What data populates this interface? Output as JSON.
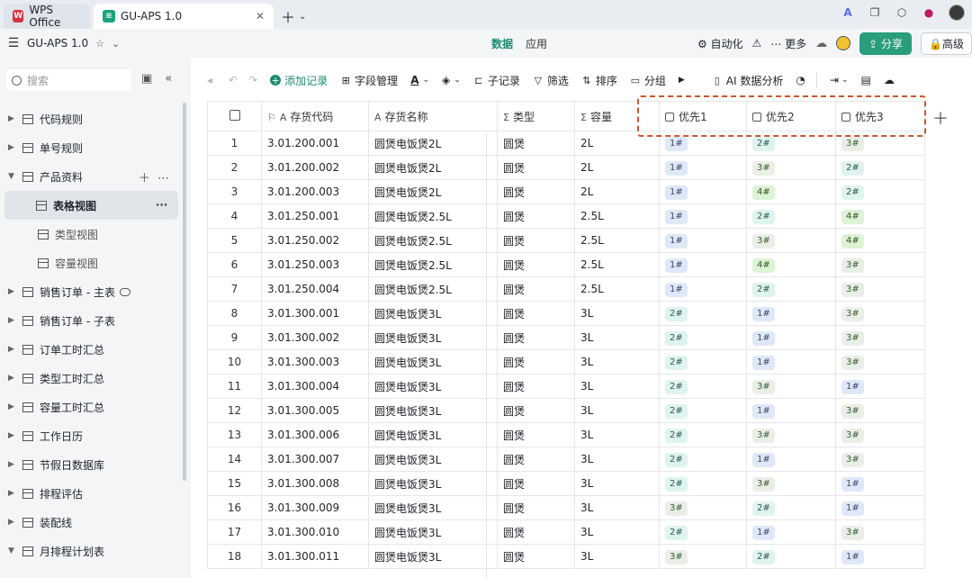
{
  "tabs": [
    {
      "label": "WPS Office",
      "active": false
    },
    {
      "label": "GU-APS 1.0",
      "active": true
    }
  ],
  "app": {
    "name": "GU-APS 1.0",
    "center_tabs": [
      "数据",
      "应用"
    ],
    "automation": "自动化",
    "more": "更多",
    "share": "分享",
    "high": "高级"
  },
  "sidebar": {
    "search_placeholder": "搜索",
    "items": [
      {
        "label": "代码规则",
        "type": "table"
      },
      {
        "label": "单号规则",
        "type": "table"
      },
      {
        "label": "产品资料",
        "type": "table",
        "expanded": true
      },
      {
        "label": "表格视图",
        "type": "view",
        "selected": true
      },
      {
        "label": "类型视图",
        "type": "view"
      },
      {
        "label": "容量视图",
        "type": "view"
      },
      {
        "label": "销售订单 - 主表",
        "type": "table",
        "cloud": true
      },
      {
        "label": "销售订单 - 子表",
        "type": "table"
      },
      {
        "label": "订单工时汇总",
        "type": "table"
      },
      {
        "label": "类型工时汇总",
        "type": "table"
      },
      {
        "label": "容量工时汇总",
        "type": "table"
      },
      {
        "label": "工作日历",
        "type": "table"
      },
      {
        "label": "节假日数据库",
        "type": "table"
      },
      {
        "label": "排程评估",
        "type": "table"
      },
      {
        "label": "装配线",
        "type": "table"
      },
      {
        "label": "月排程计划表",
        "type": "table"
      }
    ]
  },
  "toolbar": {
    "add_record": "添加记录",
    "field_manage": "字段管理",
    "sub_record": "子记录",
    "filter": "筛选",
    "sort": "排序",
    "group": "分组",
    "ai": "AI 数据分析"
  },
  "table": {
    "columns": [
      "存货代码",
      "存货名称",
      "类型",
      "容量",
      "优先1",
      "优先2",
      "优先3"
    ],
    "rows": [
      {
        "no": "1",
        "code": "3.01.200.001",
        "name": "圆煲电饭煲2L",
        "type": "圆煲",
        "cap": "2L",
        "p1": "1#",
        "p2": "2#",
        "p3": "3#"
      },
      {
        "no": "2",
        "code": "3.01.200.002",
        "name": "圆煲电饭煲2L",
        "type": "圆煲",
        "cap": "2L",
        "p1": "1#",
        "p2": "3#",
        "p3": "2#"
      },
      {
        "no": "3",
        "code": "3.01.200.003",
        "name": "圆煲电饭煲2L",
        "type": "圆煲",
        "cap": "2L",
        "p1": "1#",
        "p2": "4#",
        "p3": "2#"
      },
      {
        "no": "4",
        "code": "3.01.250.001",
        "name": "圆煲电饭煲2.5L",
        "type": "圆煲",
        "cap": "2.5L",
        "p1": "1#",
        "p2": "2#",
        "p3": "4#"
      },
      {
        "no": "5",
        "code": "3.01.250.002",
        "name": "圆煲电饭煲2.5L",
        "type": "圆煲",
        "cap": "2.5L",
        "p1": "1#",
        "p2": "3#",
        "p3": "4#"
      },
      {
        "no": "6",
        "code": "3.01.250.003",
        "name": "圆煲电饭煲2.5L",
        "type": "圆煲",
        "cap": "2.5L",
        "p1": "1#",
        "p2": "4#",
        "p3": "3#"
      },
      {
        "no": "7",
        "code": "3.01.250.004",
        "name": "圆煲电饭煲2.5L",
        "type": "圆煲",
        "cap": "2.5L",
        "p1": "1#",
        "p2": "2#",
        "p3": "3#"
      },
      {
        "no": "8",
        "code": "3.01.300.001",
        "name": "圆煲电饭煲3L",
        "type": "圆煲",
        "cap": "3L",
        "p1": "2#",
        "p2": "1#",
        "p3": "3#"
      },
      {
        "no": "9",
        "code": "3.01.300.002",
        "name": "圆煲电饭煲3L",
        "type": "圆煲",
        "cap": "3L",
        "p1": "2#",
        "p2": "1#",
        "p3": "3#"
      },
      {
        "no": "10",
        "code": "3.01.300.003",
        "name": "圆煲电饭煲3L",
        "type": "圆煲",
        "cap": "3L",
        "p1": "2#",
        "p2": "1#",
        "p3": "3#"
      },
      {
        "no": "11",
        "code": "3.01.300.004",
        "name": "圆煲电饭煲3L",
        "type": "圆煲",
        "cap": "3L",
        "p1": "2#",
        "p2": "3#",
        "p3": "1#"
      },
      {
        "no": "12",
        "code": "3.01.300.005",
        "name": "圆煲电饭煲3L",
        "type": "圆煲",
        "cap": "3L",
        "p1": "2#",
        "p2": "1#",
        "p3": "3#"
      },
      {
        "no": "13",
        "code": "3.01.300.006",
        "name": "圆煲电饭煲3L",
        "type": "圆煲",
        "cap": "3L",
        "p1": "2#",
        "p2": "3#",
        "p3": "3#"
      },
      {
        "no": "14",
        "code": "3.01.300.007",
        "name": "圆煲电饭煲3L",
        "type": "圆煲",
        "cap": "3L",
        "p1": "2#",
        "p2": "1#",
        "p3": "3#"
      },
      {
        "no": "15",
        "code": "3.01.300.008",
        "name": "圆煲电饭煲3L",
        "type": "圆煲",
        "cap": "3L",
        "p1": "2#",
        "p2": "3#",
        "p3": "1#"
      },
      {
        "no": "16",
        "code": "3.01.300.009",
        "name": "圆煲电饭煲3L",
        "type": "圆煲",
        "cap": "3L",
        "p1": "3#",
        "p2": "2#",
        "p3": "1#"
      },
      {
        "no": "17",
        "code": "3.01.300.010",
        "name": "圆煲电饭煲3L",
        "type": "圆煲",
        "cap": "3L",
        "p1": "2#",
        "p2": "1#",
        "p3": "3#"
      },
      {
        "no": "18",
        "code": "3.01.300.011",
        "name": "圆煲电饭煲3L",
        "type": "圆煲",
        "cap": "3L",
        "p1": "3#",
        "p2": "2#",
        "p3": "1#"
      }
    ]
  }
}
